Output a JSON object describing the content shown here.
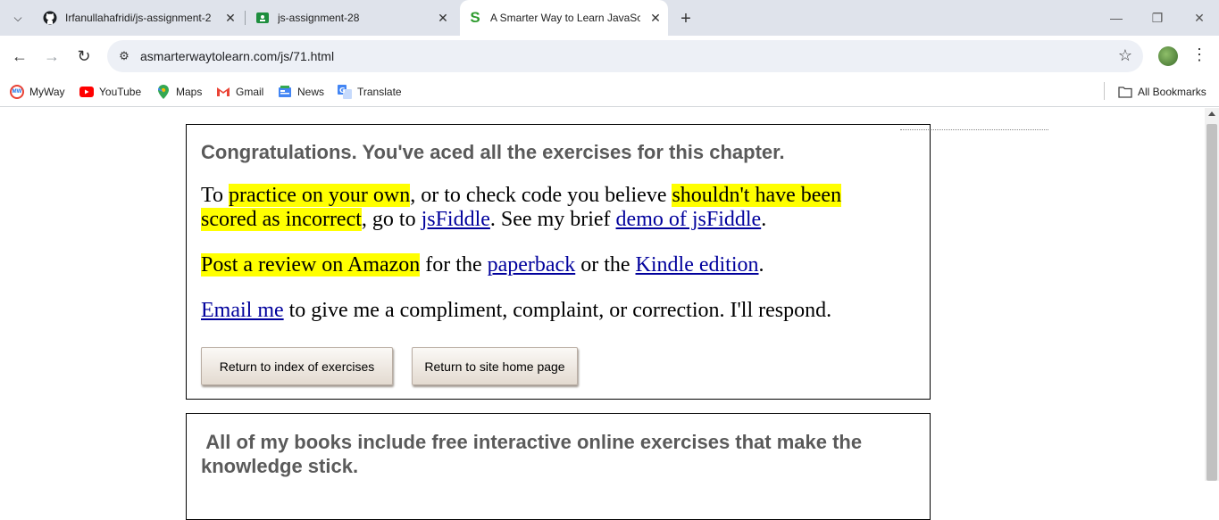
{
  "browser": {
    "tabs": [
      {
        "title": "Irfanullahafridi/js-assignment-2",
        "favicon": "github-icon"
      },
      {
        "title": "js-assignment-28",
        "favicon": "classroom-icon"
      },
      {
        "title": "A Smarter Way to Learn JavaScr",
        "favicon": "smarter-way-icon"
      }
    ],
    "url": "asmarterwaytolearn.com/js/71.html",
    "bookmarks": [
      {
        "label": "MyWay"
      },
      {
        "label": "YouTube"
      },
      {
        "label": "Maps"
      },
      {
        "label": "Gmail"
      },
      {
        "label": "News"
      },
      {
        "label": "Translate"
      }
    ],
    "all_bookmarks": "All Bookmarks"
  },
  "page": {
    "congrats_heading": "Congratulations. You've aced all the exercises for this chapter.",
    "p1": {
      "t1": "To ",
      "h1": "practice on your own",
      "t2": ", or to check code you believe ",
      "h2a": "shouldn't have been",
      "h2b": "scored as incorrect",
      "t3": ", go to ",
      "link1": "jsFiddle",
      "t4": ". See my brief ",
      "link2": "demo of jsFiddle",
      "t5": "."
    },
    "p2": {
      "h1": "Post a review on Amazon",
      "t1": " for the ",
      "link1": "paperback",
      "t2": " or the ",
      "link2": "Kindle edition",
      "t3": "."
    },
    "p3": {
      "link1": "Email me",
      "t1": " to give me a compliment, complaint, or correction. I'll respond."
    },
    "buttons": {
      "index": "Return to index of exercises",
      "home": "Return to site home page"
    },
    "books_heading_line1": " All of my books include free interactive online exercises that make the",
    "books_heading_line2": "knowledge stick."
  },
  "colors": {
    "highlight": "#ffff00",
    "link": "#00009c",
    "heading": "#5a5a5a"
  }
}
